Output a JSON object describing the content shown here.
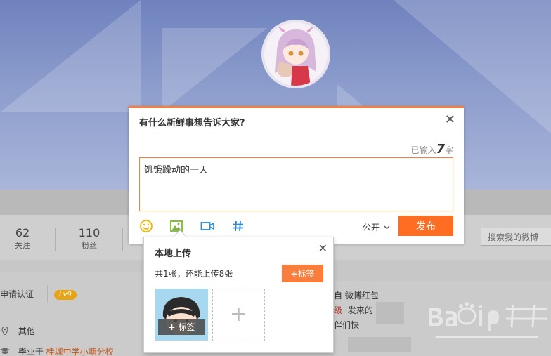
{
  "profile": {
    "stats": [
      {
        "num": "62",
        "label": "关注"
      },
      {
        "num": "110",
        "label": "粉丝"
      }
    ],
    "search_placeholder": "搜索我的微博",
    "verify_text": "申请认证",
    "level": "Lv9",
    "location": "其他",
    "school_prefix": "毕业于",
    "school_name": "桂城中学小塘分校",
    "feed_line1": "自 微博红包",
    "feed_line2_a": "级",
    "feed_line2_b": "发来的",
    "feed_line3": "伴们快"
  },
  "compose": {
    "title": "有什么新鲜事想告诉大家?",
    "counter_prefix": "已输入",
    "counter_num": "7",
    "counter_suffix": "字",
    "text": "饥饿躁动的一天",
    "visibility": "公开",
    "publish_label": "发布"
  },
  "upload": {
    "title": "本地上传",
    "count_text": "共1张，还能上传8张",
    "tag_label": "标签",
    "thumb_tag_label": "标签"
  },
  "colors": {
    "accent": "#fa7d3c",
    "publish": "#ff6d22",
    "level_badge": "#e7a414"
  }
}
